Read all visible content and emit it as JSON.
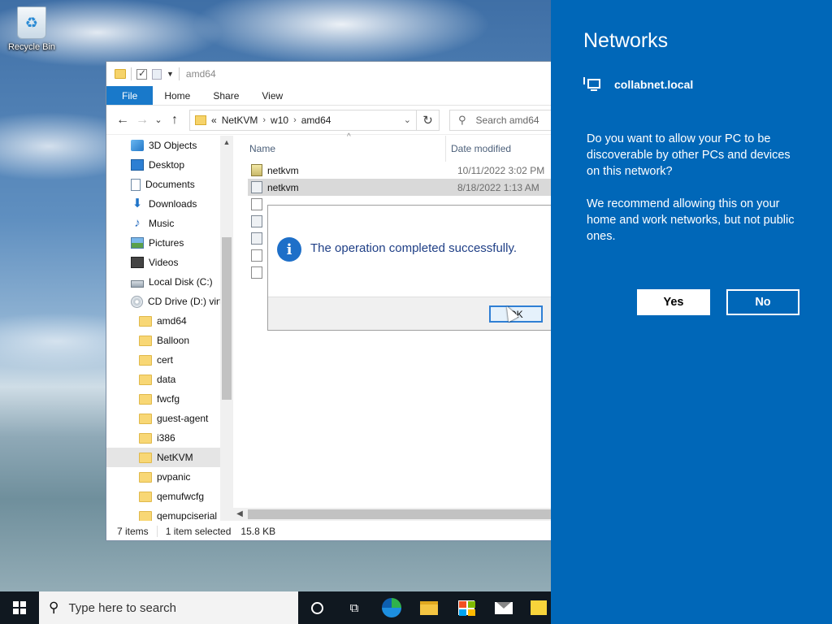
{
  "desktop": {
    "recycle_bin_label": "Recycle Bin"
  },
  "explorer": {
    "title": "amd64",
    "ribbon_tabs": [
      "File",
      "Home",
      "Share",
      "View"
    ],
    "address": {
      "prefix": "«",
      "crumbs": [
        "NetKVM",
        "w10",
        "amd64"
      ]
    },
    "search_placeholder": "Search amd64",
    "columns": {
      "name": "Name",
      "date": "Date modified"
    },
    "nav_items": [
      {
        "label": "3D Objects",
        "icon": "3d-objects-icon"
      },
      {
        "label": "Desktop",
        "icon": "desktop-icon"
      },
      {
        "label": "Documents",
        "icon": "documents-icon"
      },
      {
        "label": "Downloads",
        "icon": "downloads-icon"
      },
      {
        "label": "Music",
        "icon": "music-icon"
      },
      {
        "label": "Pictures",
        "icon": "pictures-icon"
      },
      {
        "label": "Videos",
        "icon": "videos-icon"
      },
      {
        "label": "Local Disk (C:)",
        "icon": "local-disk-icon"
      },
      {
        "label": "CD Drive (D:) virt",
        "icon": "cd-drive-icon"
      }
    ],
    "nav_folders": [
      "amd64",
      "Balloon",
      "cert",
      "data",
      "fwcfg",
      "guest-agent",
      "i386",
      "NetKVM",
      "pvpanic",
      "qemufwcfg",
      "qemupciserial"
    ],
    "selected_folder": "NetKVM",
    "files": [
      {
        "name": "netkvm",
        "date": "10/11/2022 3:02 PM",
        "icon": "catalog-file-icon"
      },
      {
        "name": "netkvm",
        "date": "8/18/2022 1:13 AM",
        "icon": "settings-file-icon",
        "selected": true
      }
    ],
    "status": {
      "items": "7 items",
      "selected": "1 item selected",
      "size": "15.8 KB"
    }
  },
  "dialog": {
    "message": "The operation completed successfully.",
    "ok_label": "OK",
    "icon": "info-icon"
  },
  "networks": {
    "title": "Networks",
    "network_name": "collabnet.local",
    "question": "Do you want to allow your PC to be discoverable by other PCs and devices on this network?",
    "recommendation": "We recommend allowing this on your home and work networks, but not public ones.",
    "yes_label": "Yes",
    "no_label": "No",
    "accent": "#0067b8"
  },
  "taskbar": {
    "search_placeholder": "Type here to search"
  }
}
